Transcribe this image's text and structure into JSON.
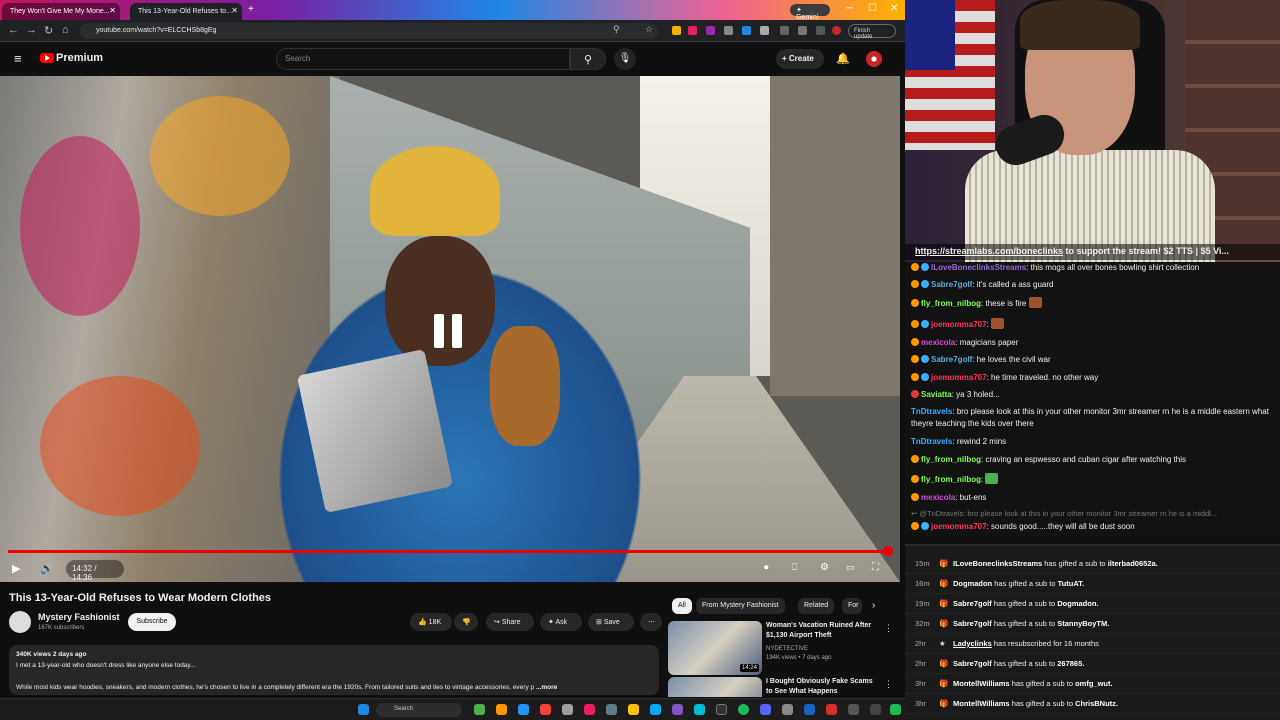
{
  "browser": {
    "tabs": [
      {
        "label": "They Won't Give Me My Mone..."
      },
      {
        "label": "This 13-Year-Old Refuses to..."
      }
    ],
    "gemini_label": "Gemini",
    "url": "youtube.com/watch?v=ELCCHSb8gEg",
    "finish_update": "Finish update"
  },
  "youtube": {
    "logo_text": "Premium",
    "search_placeholder": "Search",
    "create_label": "Create",
    "video": {
      "time": "14:32 / 14:36",
      "progress": 0.995
    },
    "title": "This 13-Year-Old Refuses to Wear Modern Clothes",
    "channel": {
      "name": "Mystery Fashionist",
      "subs": "167K subscribers",
      "subscribe_label": "Subscribe"
    },
    "actions": {
      "likes": "18K",
      "share": "Share",
      "ask": "Ask",
      "save": "Save"
    },
    "description": {
      "meta": "340K views  2 days ago",
      "line1": "I met a 13-year-old who doesn't dress like anyone else today...",
      "line2": "While most kids wear hoodies, sneakers, and modern clothes, he's chosen to live in a completely different era the 1920s. From tailored suits and ties to vintage accessories, every p",
      "more": "...more"
    },
    "chips": [
      "All",
      "From Mystery Fashionist",
      "Related",
      "For"
    ],
    "recommendations": [
      {
        "title": "Woman's Vacation Ruined After $1,130 Airport Theft",
        "channel": "NYDETECTIVE",
        "meta": "194K views • 7 days ago",
        "duration": "14:24"
      },
      {
        "title": "I Bought Obviously Fake Scams to See What Happens",
        "channel": "",
        "meta": "",
        "duration": ""
      }
    ]
  },
  "taskbar": {
    "search_label": "Search"
  },
  "stream": {
    "ticker_link": "https://streamlabs.com/boneclinks",
    "ticker_rest": " to support the stream! $2 TTS | $5 Vi..."
  },
  "chat": [
    {
      "user": "ILoveBoneclinksStreams",
      "color": "#9c6ade",
      "text": "this mogs all over bones bowling shirt collection"
    },
    {
      "user": "Sabre7golf",
      "color": "#5dade2",
      "text": "it's called a ass guard"
    },
    {
      "user": "fly_from_nilbog",
      "color": "#7dff5a",
      "text": "these is fire"
    },
    {
      "user": "joemomma707",
      "color": "#ff3355",
      "text": ""
    },
    {
      "user": "mexicola",
      "color": "#d04dd8",
      "text": "magicians paper"
    },
    {
      "user": "Sabre7golf",
      "color": "#5dade2",
      "text": "he loves the civil war"
    },
    {
      "user": "joemomma707",
      "color": "#ff3355",
      "text": "he time traveled. no other way"
    },
    {
      "user": "Saviatta",
      "color": "#7dff5a",
      "text": "ya 3 holed..."
    },
    {
      "user": "TnDtravels",
      "color": "#3ab0ff",
      "text": "bro please look at this in your other monitor 3mr streamer rn he is a middle eastern what theyre teaching the kids over there"
    },
    {
      "user": "TnDtravels",
      "color": "#3ab0ff",
      "text": "rewind 2 mins"
    },
    {
      "user": "fly_from_nilbog",
      "color": "#7dff5a",
      "text": "craving an espwesso and cuban cigar after watching this"
    },
    {
      "user": "fly_from_nilbog",
      "color": "#7dff5a",
      "text": ""
    },
    {
      "user": "mexicola",
      "color": "#d04dd8",
      "text": "but-ens"
    },
    {
      "user": "@TnDtravels",
      "color": "#888888",
      "text": "bro please look at this in your other monitor 3mr streamer rn he is a middl..."
    },
    {
      "user": "joemomma707",
      "color": "#ff3355",
      "text": "sounds good.....they will all be dust soon"
    }
  ],
  "events": [
    {
      "time": "15m",
      "user": "ILoveBoneclinksStreams",
      "text": "has gifted a sub to",
      "target": "ilterbad0652a."
    },
    {
      "time": "16m",
      "user": "Dogmadon",
      "text": "has gifted a sub to",
      "target": "TutuAT."
    },
    {
      "time": "19m",
      "user": "Sabre7golf",
      "text": "has gifted a sub to",
      "target": "Dogmadon."
    },
    {
      "time": "32m",
      "user": "Sabre7golf",
      "text": "has gifted a sub to",
      "target": "StannyBoyTM."
    },
    {
      "time": "2hr",
      "user": "Ladyclinks",
      "text": "has resubscribed for 16 months",
      "target": ""
    },
    {
      "time": "2hr",
      "user": "Sabre7golf",
      "text": "has gifted a sub to",
      "target": "267865."
    },
    {
      "time": "3hr",
      "user": "MontellWilliams",
      "text": "has gifted a sub to",
      "target": "omfg_wut."
    },
    {
      "time": "3hr",
      "user": "MontellWilliams",
      "text": "has gifted a sub to",
      "target": "ChrisBNutz."
    }
  ]
}
